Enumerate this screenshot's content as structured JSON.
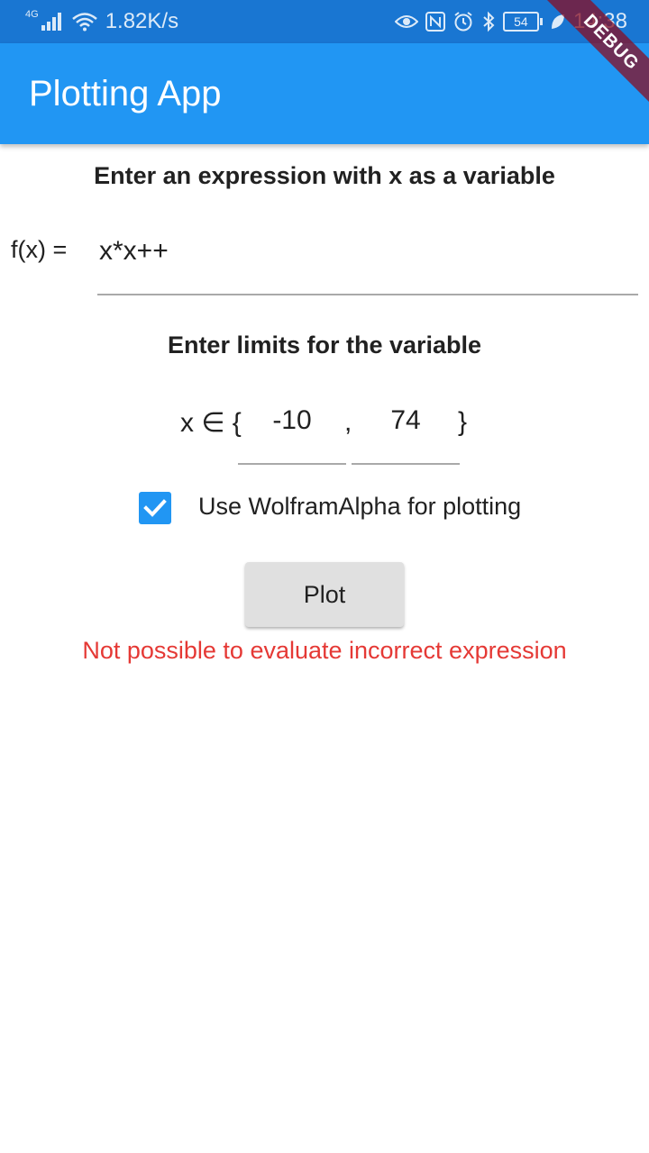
{
  "status_bar": {
    "network_type": "4G",
    "speed": "1.82K/s",
    "battery": "54",
    "time": "14:38"
  },
  "app_bar": {
    "title": "Plotting App"
  },
  "debug_banner": "DEBUG",
  "expression": {
    "heading": "Enter an expression with x as a variable",
    "label": "f(x) =",
    "value": "x*x++"
  },
  "limits": {
    "heading": "Enter limits for the variable",
    "prefix": "x ∈ {",
    "lower": "-10",
    "separator": ",",
    "upper": "74",
    "suffix": "}"
  },
  "wolfram_option": {
    "checked": true,
    "label": "Use WolframAlpha for plotting"
  },
  "plot_button": {
    "label": "Plot"
  },
  "error_message": "Not possible to evaluate incorrect expression",
  "colors": {
    "status_bar": "#1976d2",
    "app_bar": "#2196f3",
    "accent": "#2196f3",
    "error": "#e53935",
    "button": "#e0e0e0"
  }
}
